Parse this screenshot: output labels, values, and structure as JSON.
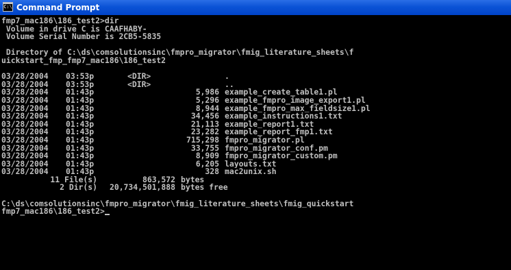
{
  "window": {
    "title": "Command Prompt",
    "icon": "cmd-window-icon",
    "icon_text": "C:\\",
    "colors": {
      "titlebar": "#0b53d6",
      "background": "#000000",
      "text": "#c0c0c0"
    }
  },
  "console": {
    "prompt_initial": "fmp7_mac186\\186_test2>",
    "command": "dir",
    "volume_label_line": " Volume in drive C is CAAFHABY-",
    "volume_serial_line": " Volume Serial Number is 2CB5-5835",
    "directory_line_1": " Directory of C:\\ds\\comsolutionsinc\\fmpro_migrator\\fmig_literature_sheets\\f",
    "directory_line_2": "uickstart_fmp_fmp7_mac186\\186_test2",
    "entries": [
      {
        "date": "03/28/2004",
        "time": "03:53p",
        "dir": "<DIR>",
        "size": "",
        "name": "."
      },
      {
        "date": "03/28/2004",
        "time": "03:53p",
        "dir": "<DIR>",
        "size": "",
        "name": ".."
      },
      {
        "date": "03/28/2004",
        "time": "01:43p",
        "dir": "",
        "size": "5,986",
        "name": "example_create_table1.pl"
      },
      {
        "date": "03/28/2004",
        "time": "01:43p",
        "dir": "",
        "size": "5,296",
        "name": "example_fmpro_image_export1.pl"
      },
      {
        "date": "03/28/2004",
        "time": "01:43p",
        "dir": "",
        "size": "8,944",
        "name": "example_fmpro_max_fieldsize1.pl"
      },
      {
        "date": "03/28/2004",
        "time": "01:43p",
        "dir": "",
        "size": "34,456",
        "name": "example_instructions1.txt"
      },
      {
        "date": "03/28/2004",
        "time": "01:43p",
        "dir": "",
        "size": "21,113",
        "name": "example_report1.txt"
      },
      {
        "date": "03/28/2004",
        "time": "01:43p",
        "dir": "",
        "size": "23,282",
        "name": "example_report_fmp1.txt"
      },
      {
        "date": "03/28/2004",
        "time": "01:43p",
        "dir": "",
        "size": "715,298",
        "name": "fmpro_migrator.pl"
      },
      {
        "date": "03/28/2004",
        "time": "01:43p",
        "dir": "",
        "size": "33,755",
        "name": "fmpro_migrator_conf.pm"
      },
      {
        "date": "03/28/2004",
        "time": "01:43p",
        "dir": "",
        "size": "8,909",
        "name": "fmpro_migrator_custom.pm"
      },
      {
        "date": "03/28/2004",
        "time": "01:43p",
        "dir": "",
        "size": "6,205",
        "name": "layouts.txt"
      },
      {
        "date": "03/28/2004",
        "time": "01:43p",
        "dir": "",
        "size": "328",
        "name": "mac2unix.sh"
      }
    ],
    "summary_files": {
      "count": "11 File(s)",
      "size": "863,572",
      "unit": "bytes"
    },
    "summary_dirs": {
      "count": "2 Dir(s)",
      "size": "20,734,501,888",
      "unit": "bytes free"
    },
    "final_prompt_line_1": "C:\\ds\\comsolutionsinc\\fmpro_migrator\\fmig_literature_sheets\\fmig_quickstart",
    "final_prompt_line_2": "fmp7_mac186\\186_test2>"
  }
}
